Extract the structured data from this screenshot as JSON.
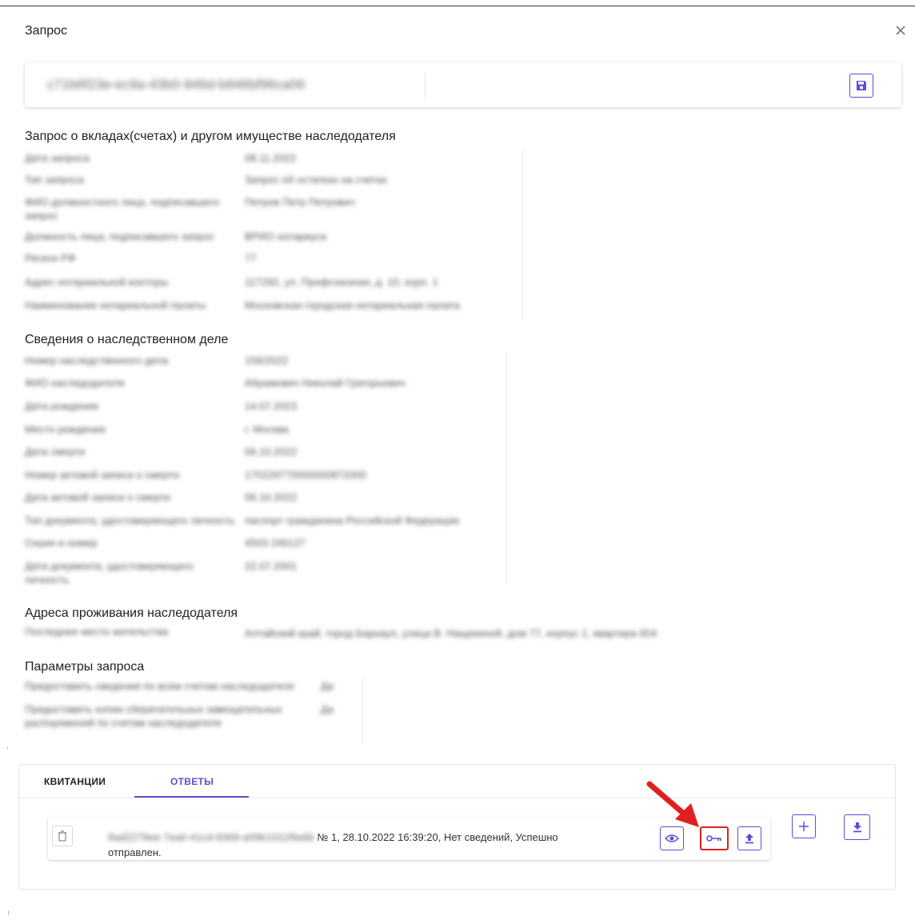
{
  "dialog": {
    "title": "Запрос"
  },
  "request_id": {
    "value": "c71b6f23e-ec9a-43b0-946d-b846bf96ca06"
  },
  "sections": {
    "deposits": {
      "title": "Запрос о вкладах(счетах) и другом имуществе наследодателя",
      "rows": [
        {
          "label": "Дата запроса",
          "value": "08.11.2022"
        },
        {
          "label": "Тип запроса",
          "value": "Запрос об остатках на счетах"
        },
        {
          "label": "ФИО должностного лица, подписавшего запрос",
          "value": "Петров Петр Петрович"
        },
        {
          "label": "Должность лица, подписавшего запрос",
          "value": "ВРИО нотариуса"
        },
        {
          "label": "Регион РФ",
          "value": "77"
        },
        {
          "label": "Адрес нотариальной конторы",
          "value": "117292, ул. Профсоюзная, д. 10, корп. 1"
        },
        {
          "label": "Наименование нотариальной палаты",
          "value": "Московская городская нотариальная палата"
        }
      ]
    },
    "inheritance": {
      "title": "Сведения о наследственном деле",
      "rows": [
        {
          "label": "Номер наследственного дела",
          "value": "156/2022"
        },
        {
          "label": "ФИО наследодателя",
          "value": "Абрамович Николай Григорьевич"
        },
        {
          "label": "Дата рождения",
          "value": "14.07.2023"
        },
        {
          "label": "Место рождения",
          "value": "г. Москва"
        },
        {
          "label": "Дата смерти",
          "value": "06.10.2022"
        },
        {
          "label": "Номер актовой записи о смерти",
          "value": "170229770000000872000"
        },
        {
          "label": "Дата актовой записи о смерти",
          "value": "06.10.2022"
        },
        {
          "label": "Тип документа, удостоверяющего личность",
          "value": "паспорт гражданина Российской Федерации"
        },
        {
          "label": "Серия и номер",
          "value": "4503 246127"
        },
        {
          "label": "Дата документа, удостоверяющего личность",
          "value": "22.07.2001"
        }
      ]
    },
    "address": {
      "title": "Адреса проживания наследодателя",
      "rows": [
        {
          "label": "Последнее место жительства",
          "value": "Алтайский край, город Барнаул, улица В. Нащекиной, дом 77, корпус 1, квартира 654"
        }
      ]
    },
    "params": {
      "title": "Параметры запроса",
      "rows": [
        {
          "label": "Предоставить сведения по всем счетам наследодателя",
          "value": "Да"
        },
        {
          "label": "Предоставить копии сберегательных завещательных распоряжений по счетам наследодателя",
          "value": "Да"
        }
      ]
    }
  },
  "tabs": [
    {
      "label": "КВИТАНЦИИ",
      "active": false
    },
    {
      "label": "ОТВЕТЫ",
      "active": true
    }
  ],
  "answer": {
    "id": "8ad2279ee-7ea0-41cd-9369-a09b1011f9a6b",
    "details": "№ 1, 28.10.2022 16:39:20, Нет сведений, Успешно",
    "status": "отправлен."
  },
  "colors": {
    "accent": "#5b4fd6",
    "highlight": "#e02020"
  },
  "icons": [
    "close-icon",
    "save-icon",
    "trash-icon",
    "eye-icon",
    "key-icon",
    "upload-icon",
    "plus-icon",
    "download-icon"
  ]
}
